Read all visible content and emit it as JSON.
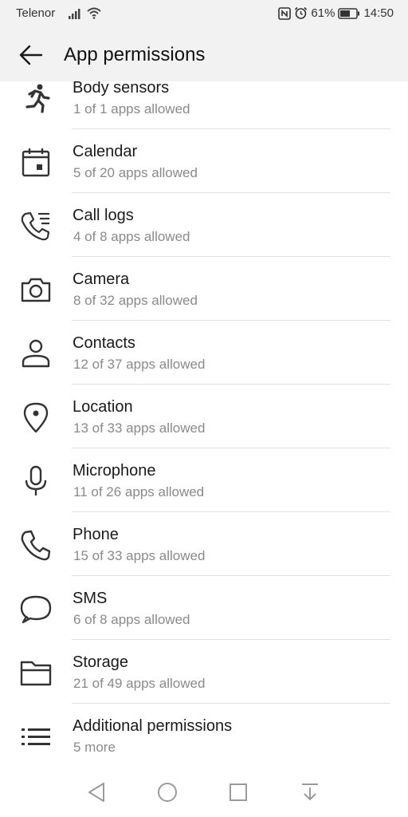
{
  "status": {
    "carrier": "Telenor",
    "battery": "61%",
    "time": "14:50"
  },
  "header": {
    "title": "App permissions"
  },
  "permissions": [
    {
      "icon": "running-person-icon",
      "title": "Body sensors",
      "subtitle": "1 of 1 apps allowed"
    },
    {
      "icon": "calendar-icon",
      "title": "Calendar",
      "subtitle": "5 of 20 apps allowed"
    },
    {
      "icon": "call-log-icon",
      "title": "Call logs",
      "subtitle": "4 of 8 apps allowed"
    },
    {
      "icon": "camera-icon",
      "title": "Camera",
      "subtitle": "8 of 32 apps allowed"
    },
    {
      "icon": "person-icon",
      "title": "Contacts",
      "subtitle": "12 of 37 apps allowed"
    },
    {
      "icon": "location-pin-icon",
      "title": "Location",
      "subtitle": "13 of 33 apps allowed"
    },
    {
      "icon": "microphone-icon",
      "title": "Microphone",
      "subtitle": "11 of 26 apps allowed"
    },
    {
      "icon": "phone-icon",
      "title": "Phone",
      "subtitle": "15 of 33 apps allowed"
    },
    {
      "icon": "chat-bubble-icon",
      "title": "SMS",
      "subtitle": "6 of 8 apps allowed"
    },
    {
      "icon": "folder-icon",
      "title": "Storage",
      "subtitle": "21 of 49 apps allowed"
    },
    {
      "icon": "list-icon",
      "title": "Additional permissions",
      "subtitle": "5 more"
    }
  ]
}
